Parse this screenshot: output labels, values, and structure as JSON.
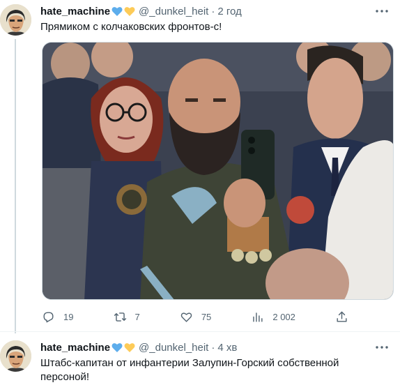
{
  "tweets": [
    {
      "display_name": "hate_machine",
      "badge_icons": [
        "blue-heart-icon",
        "yellow-heart-icon"
      ],
      "handle": "@_dunkel_heit",
      "separator": "·",
      "time": "2 год",
      "text": "Прямиком с колчаковских фронтов-с!",
      "actions": {
        "replies": "19",
        "retweets": "7",
        "likes": "75",
        "views": "2 002"
      }
    },
    {
      "display_name": "hate_machine",
      "badge_icons": [
        "blue-heart-icon",
        "yellow-heart-icon"
      ],
      "handle": "@_dunkel_heit",
      "separator": "·",
      "time": "4 хв",
      "text": "Штабс-капитан от инфантерии Залупин-Горский собственной персоной!"
    }
  ],
  "colors": {
    "heart_blue": "#5dadec",
    "heart_yellow": "#fdcb58",
    "secondary_text": "#536471",
    "thread_line": "#cfd9de"
  }
}
